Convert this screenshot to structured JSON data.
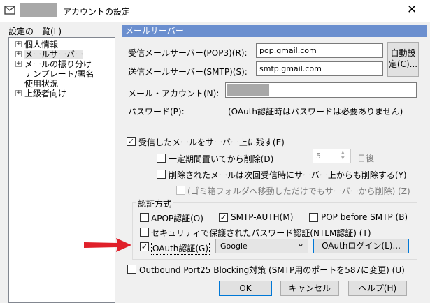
{
  "window": {
    "title": "アカウントの設定",
    "close_glyph": "✕"
  },
  "tree": {
    "label": "設定の一覧(L)",
    "items": [
      {
        "label": "個人情報",
        "expander": "+"
      },
      {
        "label": "メールサーバー",
        "expander": "+"
      },
      {
        "label": "メールの振り分け",
        "expander": "+"
      },
      {
        "label": "テンプレート/署名",
        "expander": ""
      },
      {
        "label": "使用状況",
        "expander": ""
      },
      {
        "label": "上級者向け",
        "expander": "+"
      }
    ],
    "selected_index": 1
  },
  "section": {
    "title": "メールサーバー"
  },
  "server": {
    "incoming_label": "受信メールサーバー(POP3)(R):",
    "incoming_value": "pop.gmail.com",
    "outgoing_label": "送信メールサーバー(SMTP)(S):",
    "outgoing_value": "smtp.gmail.com",
    "auto_button_line1": "自動設",
    "auto_button_line2": "定(C)...",
    "account_label": "メール・アカウント(N):",
    "password_label": "パスワード(P):",
    "password_note": "(OAuth認証時はパスワードは必要ありません)"
  },
  "leave_on_server": {
    "label": "受信したメールをサーバー上に残す(E)",
    "checked": true,
    "delete_after_label": "一定期間置いてから削除(D)",
    "delete_after_checked": false,
    "days_value": "5",
    "days_unit": "日後",
    "delete_when_deleted_label": "削除されたメールは次回受信時にサーバー上からも削除する(Y)",
    "delete_when_deleted_checked": false,
    "trash_label": "(ゴミ箱フォルダへ移動しただけでもサーバーから削除) (Z)",
    "trash_checked": false
  },
  "auth": {
    "group_title": "認証方式",
    "apop_label": "APOP認証(O)",
    "apop_checked": false,
    "smtp_auth_label": "SMTP-AUTH(M)",
    "smtp_auth_checked": true,
    "pop_before_smtp_label": "POP before SMTP (B)",
    "pop_before_smtp_checked": false,
    "secure_password_label": "セキュリティで保護されたパスワード認証(NTLM認証) (T)",
    "secure_password_checked": false,
    "oauth_label": "OAuth認証(G)",
    "oauth_checked": true,
    "provider_value": "Google",
    "oauth_login_button": "OAuthログイン(L)..."
  },
  "outbound": {
    "label": "Outbound Port25 Blocking対策 (SMTP用のポートを587に変更) (U)",
    "checked": false
  },
  "buttons": {
    "ok": "OK",
    "cancel": "キャンセル",
    "help": "ヘルプ(H)"
  },
  "glyphs": {
    "check": "✓",
    "dropdown": "⌄",
    "spin_up": "▲",
    "spin_down": "▼"
  },
  "colors": {
    "section_head": "#6b8fcf",
    "arrow": "#e0202a",
    "focus": "#0078d7"
  }
}
